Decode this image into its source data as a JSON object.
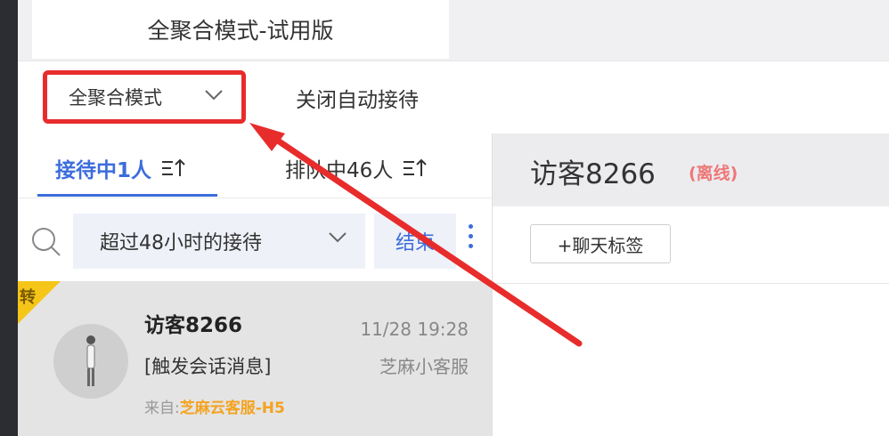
{
  "header": {
    "tab_title": "全聚合模式-试用版"
  },
  "toolbar": {
    "mode_select_value": "全聚合模式",
    "close_auto_label": "关闭自动接待"
  },
  "tabs": {
    "serving_label": "接待中1人",
    "queue_label": "排队中46人"
  },
  "filter": {
    "select_value": "超过48小时的接待",
    "end_label": "结束"
  },
  "session": {
    "badge": "转",
    "visitor_name": "访客8266",
    "time": "11/28 19:28",
    "last_message": "[触发会话消息]",
    "agent": "芝麻小客服",
    "source_label": "来自:",
    "source_value": "芝麻云客服-H5"
  },
  "detail": {
    "visitor_name": "访客8266",
    "status": "(离线)",
    "tag_button": "+聊天标签"
  },
  "colors": {
    "accent": "#3c6ddb",
    "highlight_box": "#e82c2c",
    "badge": "#f5c518",
    "source": "#f4a320"
  },
  "icons": [
    "chevron-down-icon",
    "sort-icon",
    "search-icon",
    "more-icon",
    "avatar-icon"
  ]
}
